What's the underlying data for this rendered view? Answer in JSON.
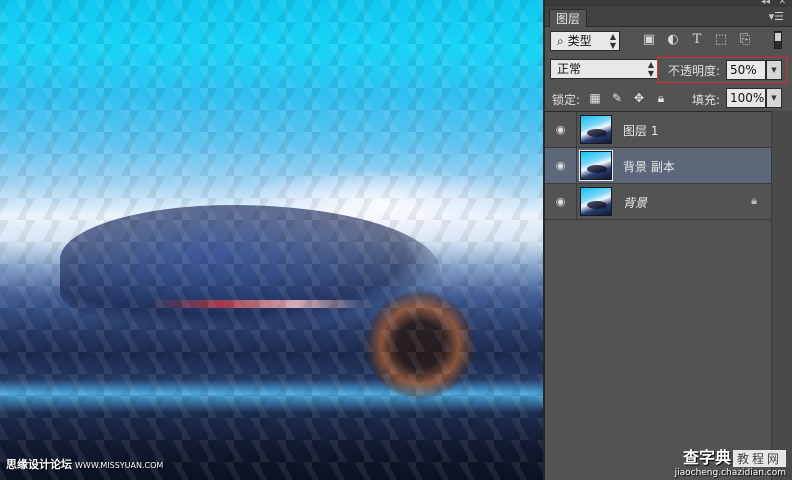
{
  "canvas": {
    "watermark_site": "思缘设计论坛",
    "watermark_url": "WWW.MISSYUAN.COM"
  },
  "panel": {
    "window_controls": [
      "◂◂",
      "✕"
    ],
    "tab_label": "图层",
    "menu_icon": "panel-menu-icon",
    "filter": {
      "label": "类型",
      "search_icon": "⌕",
      "icons": [
        "image-filter-icon",
        "adjustment-filter-icon",
        "type-filter-icon",
        "shape-filter-icon",
        "smart-object-filter-icon"
      ]
    },
    "blend_mode": "正常",
    "opacity_label": "不透明度:",
    "opacity_value": "50%",
    "lock_label": "锁定:",
    "fill_label": "填充:",
    "fill_value": "100%",
    "layers": [
      {
        "name": "图层 1",
        "visible": true,
        "selected": false,
        "locked": false
      },
      {
        "name": "背景 副本",
        "visible": true,
        "selected": true,
        "locked": false
      },
      {
        "name": "背景",
        "visible": true,
        "selected": false,
        "locked": true
      }
    ]
  },
  "watermark_right": {
    "brand": "查字典",
    "tag": "教程网",
    "url": "jiaocheng.chazidian.com"
  },
  "colors": {
    "panel_bg": "#535353",
    "selected_row": "#5c677a",
    "opacity_highlight": "#d82d2d"
  }
}
